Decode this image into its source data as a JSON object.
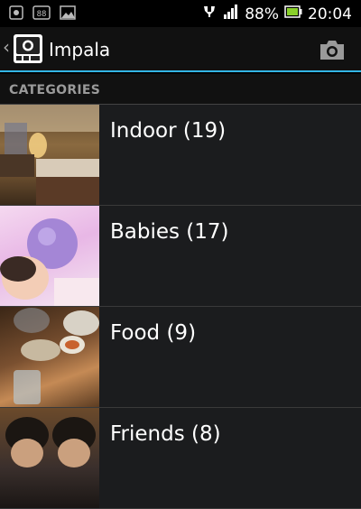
{
  "status_bar": {
    "battery_percent": "88%",
    "time": "20:04",
    "left_icons": [
      "screenshot-icon",
      "sim-toolkit-icon",
      "gallery-icon"
    ],
    "right_icons": [
      "vibrate-icon",
      "signal-icon",
      "battery-icon"
    ]
  },
  "action_bar": {
    "title": "Impala",
    "camera_icon": "camera-icon",
    "accent_color": "#33b5e5"
  },
  "section": {
    "label": "CATEGORIES"
  },
  "categories": [
    {
      "label": "Indoor (19)"
    },
    {
      "label": "Babies (17)"
    },
    {
      "label": "Food (9)"
    },
    {
      "label": "Friends (8)"
    }
  ]
}
